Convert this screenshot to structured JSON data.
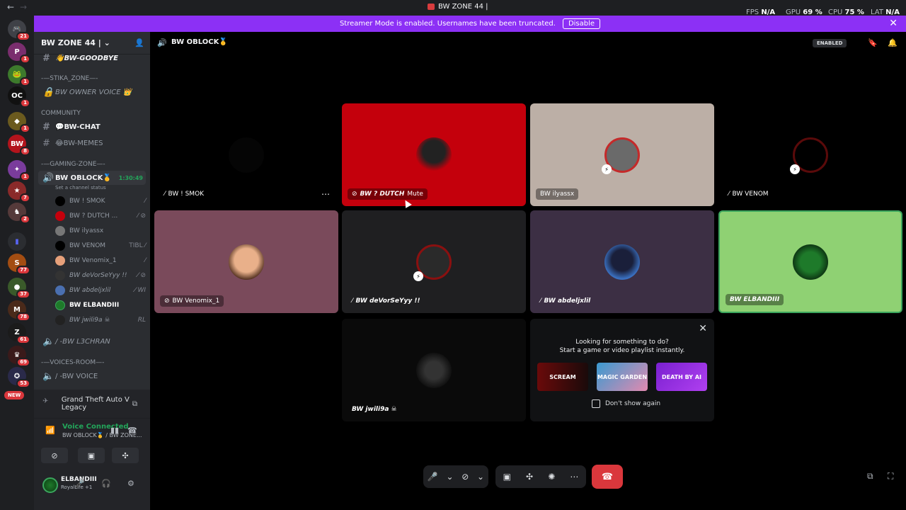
{
  "titlebar": {
    "back": "←",
    "forward": "→",
    "title": "BW ZONE 44 |",
    "fps_label": "FPS",
    "fps": "N/A",
    "gpu_label": "GPU",
    "gpu": "69 %",
    "cpu_label": "CPU",
    "cpu": "75 %",
    "lat_label": "LAT",
    "lat": "N/A"
  },
  "banner": {
    "text": "Streamer Mode is enabled. Usernames have been truncated.",
    "button": "Disable",
    "close": "✕"
  },
  "rail": {
    "badges": [
      "21",
      "1",
      "1",
      "1",
      "1",
      "8",
      "1",
      "7",
      "2",
      "77",
      "37",
      "78",
      "61",
      "69",
      "53"
    ],
    "new": "NEW"
  },
  "sidebar": {
    "server_name": "BW ZONE 44 |",
    "channels": {
      "goodbye": "👋BW-GOODBYE",
      "cat_stika": "-—STIKA_ZONE—-",
      "owner_voice": "BW OWNER VOICE 👑",
      "cat_community": "COMMUNITY",
      "chat": "💬BW-CHAT",
      "memes": "😂BW-MEMES",
      "cat_gaming": "-—GAMING-ZONE—-",
      "oblock": "BW OBLOCK🥇",
      "oblock_time": "1:30:49",
      "oblock_status": "Set a channel status",
      "l3chran": "/ -BW L3CHRAN",
      "cat_voices": "-—VOICES-ROOM—-",
      "voice": "/ -BW VOICE"
    },
    "voice_users": [
      {
        "name": "BW ! SMOK",
        "extra": ""
      },
      {
        "name": "BW ? DUTCH ...",
        "extra": ""
      },
      {
        "name": "BW ilyassx",
        "extra": ""
      },
      {
        "name": "BW VENOM",
        "extra": "TIBL"
      },
      {
        "name": "BW Venomix_1",
        "extra": ""
      },
      {
        "name": "BW deVorSeYyy !!",
        "extra": ""
      },
      {
        "name": "BW abdeljxlil",
        "extra": "WI"
      },
      {
        "name": "BW ELBANDIII",
        "extra": ""
      },
      {
        "name": "BW jwili9a ☠",
        "extra": "RL"
      }
    ],
    "game": "Grand Theft Auto V Legacy",
    "voice_connected": "Voice Connected",
    "voice_sub": "BW OBLOCK🥇 / BW ZONE...",
    "user_name": "ELBANDIII",
    "user_status": "RoyalLife +1"
  },
  "main": {
    "channel_title": "BW OBLOCK🥇",
    "enabled_badge": "ENABLED",
    "tiles": [
      {
        "name": "BW ! SMOK"
      },
      {
        "name": "BW ? DUTCH",
        "suffix": "Mute"
      },
      {
        "name": "BW ilyassx"
      },
      {
        "name": "BW VENOM"
      },
      {
        "name": "BW Venomix_1"
      },
      {
        "name": "BW deVorSeYyy !!"
      },
      {
        "name": "BW abdeljxlil"
      },
      {
        "name": "BW ELBANDIII"
      },
      {
        "name": "BW jwili9a ☠"
      }
    ],
    "activity": {
      "line1": "Looking for something to do?",
      "line2": "Start a game or video playlist instantly.",
      "games": [
        "SCREAM",
        "MAGIC GARDEN",
        "DEATH BY AI"
      ],
      "checkbox": "Don't show again"
    }
  },
  "colors": {
    "accent": "#8c30f5",
    "danger": "#da373c",
    "online": "#23a55a",
    "tile_red": "#c4000c",
    "tile_beige": "#bcafa6",
    "tile_mauve": "#7a4a5b",
    "tile_purple": "#3c2f44",
    "tile_green": "#8fd173"
  }
}
